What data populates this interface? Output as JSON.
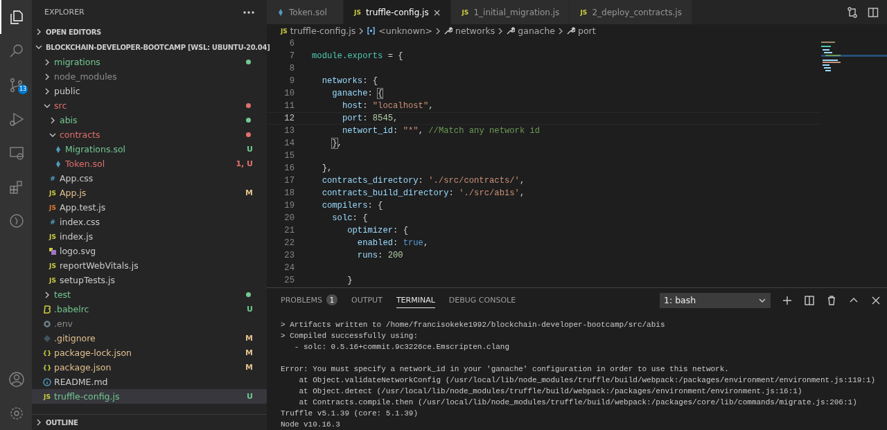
{
  "activity_bar": {
    "items": [
      {
        "kind": "files",
        "selected": true
      },
      {
        "kind": "search",
        "selected": false
      },
      {
        "kind": "source-control",
        "selected": false,
        "badge": "13"
      },
      {
        "kind": "run",
        "selected": false
      },
      {
        "kind": "remote",
        "selected": false
      },
      {
        "kind": "extensions",
        "selected": false
      },
      {
        "kind": "timeline",
        "selected": false
      }
    ],
    "bottom": [
      {
        "kind": "account"
      },
      {
        "kind": "settings"
      }
    ]
  },
  "sidebar": {
    "title": "EXPLORER",
    "sections": [
      {
        "title": "OPEN EDITORS",
        "expanded": false
      },
      {
        "title": "BLOCKCHAIN-DEVELOPER-BOOTCAMP [WSL: UBUNTU-20.04]",
        "expanded": true,
        "children": [
          {
            "name": "migrations",
            "kind": "folder",
            "expanded": false,
            "color": "#73c991",
            "dot": true,
            "selected": false
          },
          {
            "name": "node_modules",
            "kind": "folder",
            "expanded": false,
            "color": "#8c8c8c",
            "dot": false,
            "selected": false
          },
          {
            "name": "public",
            "kind": "folder",
            "expanded": false,
            "color": "#cccccc",
            "dot": false,
            "selected": false
          },
          {
            "name": "src",
            "kind": "folder",
            "expanded": true,
            "color": "#e0706c",
            "dot": true,
            "selected": false,
            "children": [
              {
                "name": "abis",
                "kind": "folder",
                "expanded": false,
                "color": "#73c991",
                "dot": true,
                "selected": false
              },
              {
                "name": "contracts",
                "kind": "folder",
                "expanded": true,
                "color": "#e0706c",
                "dot": true,
                "selected": false,
                "children": [
                  {
                    "name": "Migrations.sol",
                    "kind": "sol",
                    "color": "#73c991",
                    "badge": "U",
                    "selected": false
                  },
                  {
                    "name": "Token.sol",
                    "kind": "sol",
                    "color": "#e0706c",
                    "badge": "1, U",
                    "selected": false
                  }
                ]
              },
              {
                "name": "App.css",
                "kind": "css",
                "glyph": "#",
                "color": "#cccccc",
                "selected": false
              },
              {
                "name": "App.js",
                "kind": "js",
                "glyph": "JS",
                "color": "#e2c08d",
                "badge": "M",
                "selected": false
              },
              {
                "name": "App.test.js",
                "kind": "js-test",
                "glyph": "JS",
                "color": "#cccccc",
                "selected": false
              },
              {
                "name": "index.css",
                "kind": "css",
                "glyph": "#",
                "color": "#cccccc",
                "selected": false
              },
              {
                "name": "index.js",
                "kind": "js",
                "glyph": "JS",
                "color": "#cccccc",
                "selected": false
              },
              {
                "name": "logo.svg",
                "kind": "svg",
                "color": "#cccccc",
                "selected": false
              },
              {
                "name": "reportWebVitals.js",
                "kind": "js",
                "glyph": "JS",
                "color": "#cccccc",
                "selected": false
              },
              {
                "name": "setupTests.js",
                "kind": "js",
                "glyph": "JS",
                "color": "#cccccc",
                "selected": false
              }
            ]
          },
          {
            "name": "test",
            "kind": "folder",
            "expanded": false,
            "color": "#73c991",
            "dot": true,
            "selected": false
          },
          {
            "name": ".babelrc",
            "kind": "babel",
            "color": "#73c991",
            "badge": "U",
            "selected": false
          },
          {
            "name": ".env",
            "kind": "env",
            "color": "#8c8c8c",
            "selected": false
          },
          {
            "name": ".gitignore",
            "kind": "git",
            "color": "#e2c08d",
            "badge": "M",
            "selected": false
          },
          {
            "name": "package-lock.json",
            "kind": "json",
            "glyph": "{}",
            "color": "#e2c08d",
            "badge": "M",
            "selected": false
          },
          {
            "name": "package.json",
            "kind": "json",
            "glyph": "{}",
            "color": "#e2c08d",
            "badge": "M",
            "selected": false
          },
          {
            "name": "README.md",
            "kind": "info",
            "color": "#cccccc",
            "selected": false
          },
          {
            "name": "truffle-config.js",
            "kind": "js",
            "glyph": "JS",
            "color": "#73c991",
            "badge": "U",
            "selected": true
          }
        ]
      },
      {
        "title": "OUTLINE",
        "expanded": false
      }
    ]
  },
  "tabs": [
    {
      "label": "Token.sol",
      "kind": "sol",
      "selected": false
    },
    {
      "label": "truffle-config.js",
      "kind": "js",
      "glyph": "JS",
      "selected": true,
      "close": "×"
    },
    {
      "label": "1_initial_migration.js",
      "kind": "js",
      "glyph": "JS",
      "selected": false
    },
    {
      "label": "2_deploy_contracts.js",
      "kind": "js",
      "glyph": "JS",
      "selected": false
    }
  ],
  "breadcrumb": [
    {
      "label": "truffle-config.js",
      "kind": "js",
      "glyph": "JS"
    },
    {
      "label": "<unknown>",
      "kind": "module"
    },
    {
      "label": "networks",
      "kind": "property"
    },
    {
      "label": "ganache",
      "kind": "property"
    },
    {
      "label": "port",
      "kind": "property"
    }
  ],
  "editor": {
    "lines": [
      {
        "number": "6",
        "current": false
      },
      {
        "number": "7",
        "current": false,
        "tokens": [
          {
            "kind": "var",
            "text": "module.exports"
          },
          {
            "kind": "punct",
            "text": " = {"
          }
        ]
      },
      {
        "number": "8",
        "current": false
      },
      {
        "number": "9",
        "current": false,
        "tokens": [
          {
            "kind": "prop",
            "text": "  networks"
          },
          {
            "kind": "punct",
            "text": ": {"
          }
        ]
      },
      {
        "number": "10",
        "current": false,
        "tokens": [
          {
            "kind": "prop",
            "text": "    ganache"
          },
          {
            "kind": "punct",
            "text": ": "
          },
          {
            "kind": "match",
            "text": "{"
          }
        ]
      },
      {
        "number": "11",
        "current": false,
        "tokens": [
          {
            "kind": "prop",
            "text": "      host"
          },
          {
            "kind": "punct",
            "text": ": "
          },
          {
            "kind": "string",
            "text": "\"localhost\""
          },
          {
            "kind": "punct",
            "text": ","
          }
        ]
      },
      {
        "number": "12",
        "current": true,
        "tokens": [
          {
            "kind": "prop",
            "text": "      port"
          },
          {
            "kind": "punct",
            "text": ": "
          },
          {
            "kind": "number",
            "text": "8545"
          },
          {
            "kind": "punct",
            "text": ","
          }
        ]
      },
      {
        "number": "13",
        "current": false,
        "tokens": [
          {
            "kind": "prop",
            "text": "      networt_id"
          },
          {
            "kind": "punct",
            "text": ": "
          },
          {
            "kind": "string",
            "text": "\"*\""
          },
          {
            "kind": "punct",
            "text": ", "
          },
          {
            "kind": "comment",
            "text": "//Match any network id"
          }
        ]
      },
      {
        "number": "14",
        "current": false,
        "tokens": [
          {
            "kind": "match",
            "text": "    }"
          },
          {
            "kind": "punct",
            "text": ","
          }
        ]
      },
      {
        "number": "15",
        "current": false
      },
      {
        "number": "16",
        "current": false,
        "tokens": [
          {
            "kind": "punct",
            "text": "  },"
          }
        ]
      },
      {
        "number": "17",
        "current": false,
        "tokens": [
          {
            "kind": "prop",
            "text": "  contracts_directory"
          },
          {
            "kind": "punct",
            "text": ": "
          },
          {
            "kind": "string",
            "text": "'./src/contracts/'"
          },
          {
            "kind": "punct",
            "text": ","
          }
        ]
      },
      {
        "number": "18",
        "current": false,
        "tokens": [
          {
            "kind": "prop",
            "text": "  contracts_build_directory"
          },
          {
            "kind": "punct",
            "text": ": "
          },
          {
            "kind": "string",
            "text": "'./src/abis'"
          },
          {
            "kind": "punct",
            "text": ","
          }
        ]
      },
      {
        "number": "19",
        "current": false,
        "tokens": [
          {
            "kind": "prop",
            "text": "  compilers"
          },
          {
            "kind": "punct",
            "text": ": {"
          }
        ]
      },
      {
        "number": "20",
        "current": false,
        "tokens": [
          {
            "kind": "prop",
            "text": "    solc"
          },
          {
            "kind": "punct",
            "text": ": {"
          }
        ]
      },
      {
        "number": "21",
        "current": false,
        "tokens": [
          {
            "kind": "prop",
            "text": "       optimizer"
          },
          {
            "kind": "punct",
            "text": ": {"
          }
        ]
      },
      {
        "number": "22",
        "current": false,
        "tokens": [
          {
            "kind": "prop",
            "text": "         enabled"
          },
          {
            "kind": "punct",
            "text": ": "
          },
          {
            "kind": "bool",
            "text": "true"
          },
          {
            "kind": "punct",
            "text": ","
          }
        ]
      },
      {
        "number": "23",
        "current": false,
        "tokens": [
          {
            "kind": "prop",
            "text": "         runs"
          },
          {
            "kind": "punct",
            "text": ": "
          },
          {
            "kind": "number",
            "text": "200"
          }
        ]
      },
      {
        "number": "24",
        "current": false
      },
      {
        "number": "25",
        "current": false,
        "tokens": [
          {
            "kind": "punct",
            "text": "       }"
          }
        ]
      }
    ]
  },
  "panel": {
    "tabs": [
      {
        "label": "PROBLEMS",
        "badge": "1",
        "selected": false
      },
      {
        "label": "OUTPUT",
        "selected": false
      },
      {
        "label": "TERMINAL",
        "selected": true
      },
      {
        "label": "DEBUG CONSOLE",
        "selected": false
      }
    ],
    "terminal_select": "1: bash",
    "terminal_blocks": [
      {
        "lines": [
          "> Artifacts written to /home/francisokeke1992/blockchain-developer-bootcamp/src/abis",
          "> Compiled successfully using:",
          "   - solc: 0.5.16+commit.9c3226ce.Emscripten.clang"
        ]
      },
      {
        "lines": [
          "Error: You must specify a network_id in your 'ganache' configuration in order to use this network.",
          "    at Object.validateNetworkConfig (/usr/local/lib/node_modules/truffle/build/webpack:/packages/environment/environment.js:119:1)",
          "    at Object.detect (/usr/local/lib/node_modules/truffle/build/webpack:/packages/environment/environment.js:16:1)",
          "    at Contracts.compile.then (/usr/local/lib/node_modules/truffle/build/webpack:/packages/core/lib/commands/migrate.js:206:1)",
          "Truffle v5.1.39 (core: 5.1.39)",
          "Node v10.16.3"
        ]
      }
    ]
  }
}
